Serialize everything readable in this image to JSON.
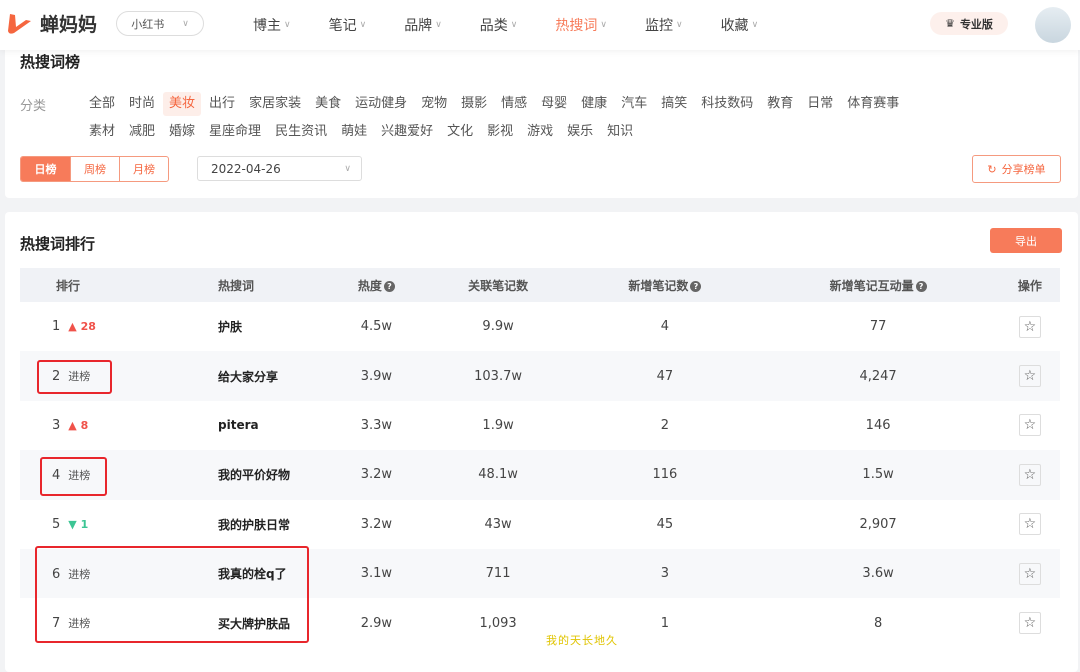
{
  "header": {
    "brand": "蝉妈妈",
    "platform": "小红书",
    "nav": [
      {
        "label": "博主"
      },
      {
        "label": "笔记"
      },
      {
        "label": "品牌"
      },
      {
        "label": "品类"
      },
      {
        "label": "热搜词",
        "active": true
      },
      {
        "label": "监控"
      },
      {
        "label": "收藏"
      }
    ],
    "pro_label": "专业版",
    "accent": "#f77b5a"
  },
  "filter": {
    "title": "热搜词榜",
    "category_label": "分类",
    "categories": [
      "全部",
      "时尚",
      "美妆",
      "出行",
      "家居家装",
      "美食",
      "运动健身",
      "宠物",
      "摄影",
      "情感",
      "母婴",
      "健康",
      "汽车",
      "搞笑",
      "科技数码",
      "教育",
      "日常",
      "体育赛事",
      "素材",
      "减肥",
      "婚嫁",
      "星座命理",
      "民生资讯",
      "萌娃",
      "兴趣爱好",
      "文化",
      "影视",
      "游戏",
      "娱乐",
      "知识"
    ],
    "active_category": "美妆",
    "periods": [
      "日榜",
      "周榜",
      "月榜"
    ],
    "active_period": "日榜",
    "date": "2022-04-26",
    "share_label": "分享榜单"
  },
  "ranking": {
    "title": "热搜词排行",
    "export_label": "导出",
    "columns": [
      "排行",
      "热搜词",
      "热度",
      "关联笔记数",
      "新增笔记数",
      "新增笔记互动量",
      "操作"
    ],
    "rows": [
      {
        "rank": "1",
        "change": "28",
        "trend": "up",
        "keyword": "护肤",
        "heat": "4.5w",
        "related": "9.9w",
        "new_notes": "4",
        "interaction": "77"
      },
      {
        "rank": "2",
        "change": "进榜",
        "trend": "new",
        "keyword": "给大家分享",
        "heat": "3.9w",
        "related": "103.7w",
        "new_notes": "47",
        "interaction": "4,247"
      },
      {
        "rank": "3",
        "change": "8",
        "trend": "up",
        "keyword": "pitera",
        "heat": "3.3w",
        "related": "1.9w",
        "new_notes": "2",
        "interaction": "146"
      },
      {
        "rank": "4",
        "change": "进榜",
        "trend": "new",
        "keyword": "我的平价好物",
        "heat": "3.2w",
        "related": "48.1w",
        "new_notes": "116",
        "interaction": "1.5w"
      },
      {
        "rank": "5",
        "change": "1",
        "trend": "down",
        "keyword": "我的护肤日常",
        "heat": "3.2w",
        "related": "43w",
        "new_notes": "45",
        "interaction": "2,907"
      },
      {
        "rank": "6",
        "change": "进榜",
        "trend": "new",
        "keyword": "我真的栓q了",
        "heat": "3.1w",
        "related": "711",
        "new_notes": "3",
        "interaction": "3.6w"
      },
      {
        "rank": "7",
        "change": "进榜",
        "trend": "new",
        "keyword": "买大牌护肤品",
        "heat": "2.9w",
        "related": "1,093",
        "new_notes": "1",
        "interaction": "8"
      }
    ]
  },
  "watermark": "我的天长地久"
}
